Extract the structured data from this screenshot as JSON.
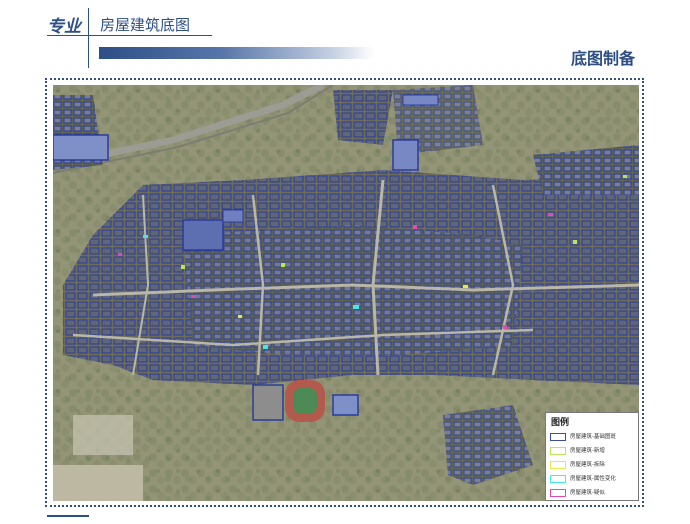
{
  "header": {
    "tag": "专业",
    "topic": "房屋建筑底图",
    "section_title": "底图制备"
  },
  "map": {
    "legend": {
      "title": "图例",
      "items": [
        {
          "label": "房屋建筑-基础图斑",
          "color": "#3a4fa3"
        },
        {
          "label": "房屋建筑-新增",
          "color": "#b6e85a"
        },
        {
          "label": "房屋建筑-拆除",
          "color": "#e8e84a"
        },
        {
          "label": "房屋建筑-属性变化",
          "color": "#48e6ea"
        },
        {
          "label": "房屋建筑-疑似",
          "color": "#e84ab4"
        }
      ]
    }
  },
  "colors": {
    "accent": "#2d4f86"
  }
}
